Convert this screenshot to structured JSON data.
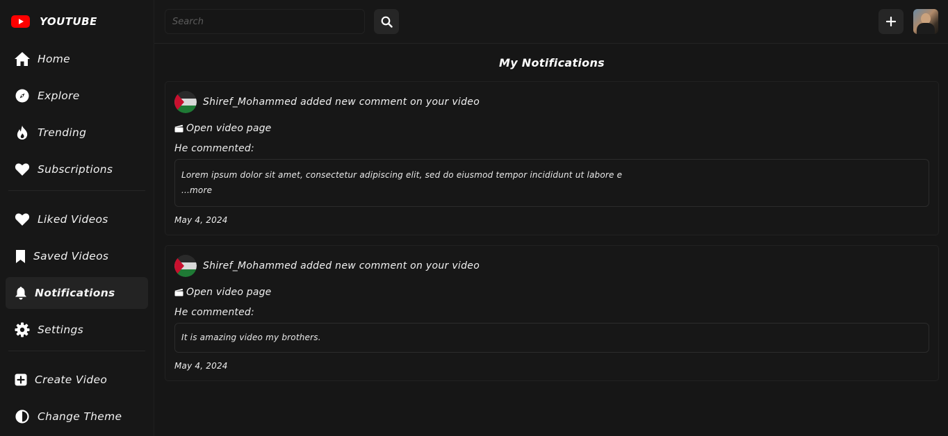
{
  "app": {
    "name": "YOUTUBE",
    "brand_color": "#ff0000"
  },
  "sidebar": {
    "primary": [
      {
        "label": "Home",
        "icon": "home-icon"
      },
      {
        "label": "Explore",
        "icon": "compass-icon"
      },
      {
        "label": "Trending",
        "icon": "fire-icon"
      },
      {
        "label": "Subscriptions",
        "icon": "heart-icon"
      }
    ],
    "library": [
      {
        "label": "Liked Videos",
        "icon": "heart-icon"
      },
      {
        "label": "Saved Videos",
        "icon": "bookmark-icon"
      },
      {
        "label": "Notifications",
        "icon": "bell-icon",
        "active": true
      },
      {
        "label": "Settings",
        "icon": "gear-icon"
      }
    ],
    "extra": [
      {
        "label": "Create Video",
        "icon": "plus-square-icon"
      },
      {
        "label": "Change Theme",
        "icon": "contrast-icon"
      }
    ]
  },
  "topbar": {
    "search_placeholder": "Search",
    "search_icon": "search-icon",
    "create_icon": "plus-icon"
  },
  "page": {
    "title": "My Notifications"
  },
  "notifications": [
    {
      "text": "Shiref_Mohammed added new comment on your video",
      "open_link": "Open video page",
      "commented_label": "He commented:",
      "comment": "Lorem ipsum dolor sit amet, consectetur adipiscing elit, sed do eiusmod tempor incididunt ut labore e",
      "more": "...more",
      "date": "May 4, 2024"
    },
    {
      "text": "Shiref_Mohammed added new comment on your video",
      "open_link": "Open video page",
      "commented_label": "He commented:",
      "comment": "It is amazing video my brothers.",
      "date": "May 4, 2024"
    }
  ]
}
